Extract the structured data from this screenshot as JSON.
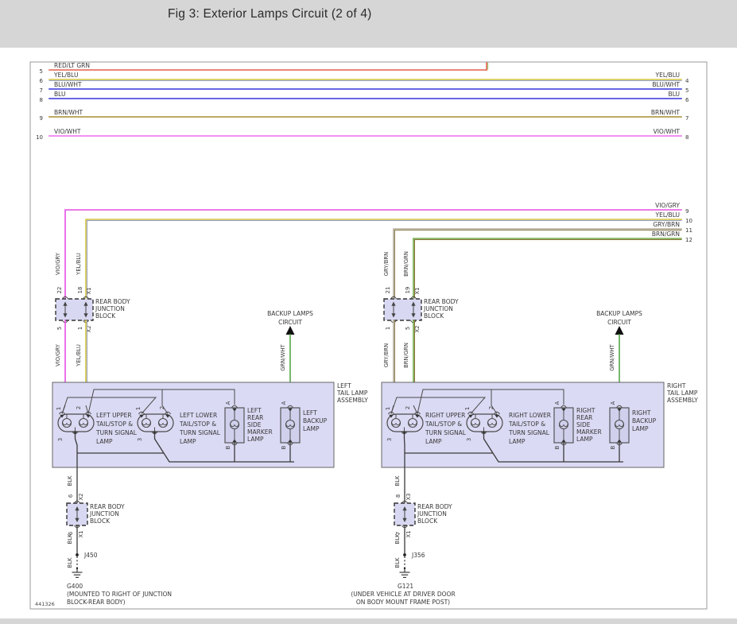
{
  "header": {
    "title": "Fig 3: Exterior Lamps Circuit (2 of 4)"
  },
  "footer": {
    "number": "441326"
  },
  "colors": {
    "header_bg": "#d6d6d6",
    "canvas": "#ffffff",
    "frame": "#9a9a9a",
    "text": "#383838",
    "red_ltgrn": "#e2604c",
    "ltgrn": "#8cc063",
    "yel": "#d2c23e",
    "yel_blu2": "#95a0c8",
    "blu": "#3333dd",
    "brn_wht": "#a68d2f",
    "vio_wht": "#ef6cef",
    "vio_gry": "#e44fe4",
    "gry_brn1": "#b0aa96",
    "gry_brn2": "#8d7f50",
    "brn_grn1": "#8a7138",
    "brn_grn2": "#6fa845",
    "grn_wht": "#55a648",
    "blk": "#3a3a3a",
    "block_fill": "#d8d8f2",
    "assembly_fill": "#dbdaf4",
    "lamp_fill": "#d0d0ed"
  },
  "top": {
    "wires": [
      {
        "lp": "5",
        "ll": "RED/LT GRN"
      },
      {
        "lp": "6",
        "ll": "YEL/BLU",
        "rp": "4",
        "rl": "YEL/BLU"
      },
      {
        "lp": "7",
        "ll": "BLU/WHT",
        "rp": "5",
        "rl": "BLU/WHT"
      },
      {
        "lp": "8",
        "ll": "BLU",
        "rp": "6",
        "rl": "BLU"
      },
      {
        "lp": "9",
        "ll": "BRN/WHT",
        "rp": "7",
        "rl": "BRN/WHT"
      },
      {
        "lp": "10",
        "ll": "VIO/WHT",
        "rp": "8",
        "rl": "VIO/WHT"
      }
    ]
  },
  "mid": {
    "wires": [
      {
        "rp": "9",
        "l": "VIO/GRY"
      },
      {
        "rp": "10",
        "l": "YEL/BLU"
      },
      {
        "rp": "11",
        "l": "GRY/BRN"
      },
      {
        "rp": "12",
        "l": "BRN/GRN"
      }
    ]
  },
  "wl": {
    "vio_gry": "VIO/GRY",
    "yel_blu": "YEL/BLU",
    "gry_brn": "GRY/BRN",
    "brn_grn": "BRN/GRN",
    "grn_wht": "GRN/WHT",
    "blk": "BLK"
  },
  "jb": {
    "name": [
      "REAR BODY",
      "JUNCTION",
      "BLOCK"
    ],
    "ul": {
      "t1": "22",
      "t2": "18",
      "tc": "X1",
      "b1": "5",
      "b2": "1",
      "bc": "X2"
    },
    "ur": {
      "t1": "21",
      "t2": "19",
      "tc": "X1",
      "b1": "1",
      "b2": "5",
      "bc": "X2"
    },
    "ll": {
      "t": "6",
      "tc": "X2",
      "b": "6",
      "bc": "X1"
    },
    "lr": {
      "t": "8",
      "tc": "X3",
      "b": "7",
      "bc": "X1"
    }
  },
  "backup": {
    "l1": "BACKUP LAMPS",
    "l2": "CIRCUIT",
    "wire": "GRN/WHT"
  },
  "asm": {
    "pins": {
      "p1": "1",
      "p2": "2",
      "p3": "3",
      "pa": "A",
      "pb": "B"
    },
    "left": {
      "name": [
        "LEFT",
        "TAIL LAMP",
        "ASSEMBLY"
      ],
      "upper": [
        "LEFT UPPER",
        "TAIL/STOP &",
        "TURN SIGNAL",
        "LAMP"
      ],
      "lower": [
        "LEFT LOWER",
        "TAIL/STOP &",
        "TURN SIGNAL",
        "LAMP"
      ],
      "marker": [
        "LEFT",
        "REAR",
        "SIDE",
        "MARKER",
        "LAMP"
      ],
      "backup": [
        "LEFT",
        "BACKUP",
        "LAMP"
      ]
    },
    "right": {
      "name": [
        "RIGHT",
        "TAIL LAMP",
        "ASSEMBLY"
      ],
      "upper": [
        "RIGHT UPPER",
        "TAIL/STOP &",
        "TURN SIGNAL",
        "LAMP"
      ],
      "lower": [
        "RIGHT LOWER",
        "TAIL/STOP &",
        "TURN SIGNAL",
        "LAMP"
      ],
      "marker": [
        "RIGHT",
        "REAR",
        "SIDE",
        "MARKER",
        "LAMP"
      ],
      "backup": [
        "RIGHT",
        "BACKUP",
        "LAMP"
      ]
    }
  },
  "gnd": {
    "left": {
      "splice": "J450",
      "gid": "G400",
      "cap": [
        "(MOUNTED TO RIGHT OF JUNCTION",
        "BLOCK-REAR BODY)"
      ]
    },
    "right": {
      "splice": "J356",
      "gid": "G121",
      "cap": [
        "(UNDER VEHICLE AT DRIVER DOOR",
        "ON BODY MOUNT FRAME POST)"
      ]
    }
  }
}
